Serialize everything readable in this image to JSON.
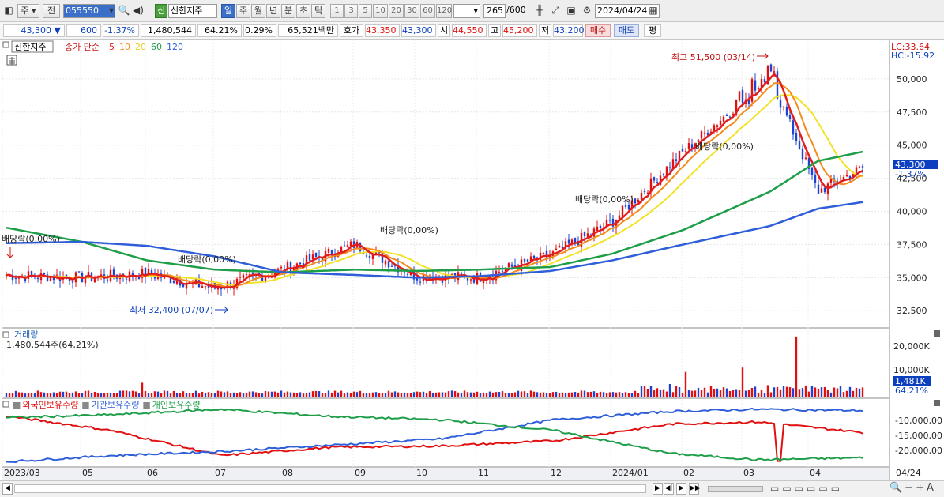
{
  "toolbar": {
    "market": "주",
    "prev": "전",
    "code": "055550",
    "badge": "신",
    "name": "신한지주",
    "periods": [
      "일",
      "주",
      "월",
      "년",
      "분",
      "초",
      "틱"
    ],
    "numbers": [
      "1",
      "3",
      "5",
      "10",
      "20",
      "30",
      "60",
      "120"
    ],
    "count": "265",
    "count_max": "/600",
    "date": "2024/04/24"
  },
  "quote": {
    "price": "43,300",
    "arrow": "▼",
    "change": "600",
    "change_pct": "-1.37%",
    "volume": "1,480,544",
    "vol_rate": "64.21%",
    "turnover": "0.29%",
    "amount": "65,521백만",
    "bid_label": "호가",
    "ask": "43,350",
    "bid": "43,300",
    "open_label": "시",
    "open": "44,550",
    "high_label": "고",
    "high": "45,200",
    "low_label": "저",
    "low": "43,200",
    "buy": "매수",
    "sell": "매도",
    "avg": "평"
  },
  "price_panel": {
    "name": "신한지주",
    "legend_title": "종가 단순",
    "ma": [
      {
        "label": "5",
        "color": "#e01e1e"
      },
      {
        "label": "10",
        "color": "#f28c1c"
      },
      {
        "label": "20",
        "color": "#e8d21a"
      },
      {
        "label": "60",
        "color": "#1f9e4a"
      },
      {
        "label": "120",
        "color": "#2f5fd8"
      }
    ],
    "lc": "LC:33.64",
    "hc": "HC:-15.92",
    "y_labels": [
      "50,000",
      "47,500",
      "45,000",
      "42,500",
      "40,000",
      "37,500",
      "35,000",
      "32,500"
    ],
    "last_price": "43,300",
    "last_pct": "-1.37%",
    "ann_high": "최고 51,500 (03/14)",
    "ann_low": "최저 32,400 (07/07)",
    "dividend": [
      "배당락(0,00%)",
      "배당락(0,00%)",
      "배당락(0,00%)",
      "배당락(0,00%)",
      "배당락(0,00%)"
    ]
  },
  "volume_panel": {
    "title": "거래량",
    "value": "1,480,544주(64,21%)",
    "y_labels": [
      "20,000K",
      "10,000K"
    ],
    "last": "1,481K",
    "last_pct": "64.21%"
  },
  "holding_panel": {
    "legend": [
      {
        "label": "외국인보유수량",
        "color": "#e01010"
      },
      {
        "label": "기관보유수량",
        "color": "#2f5fd8"
      },
      {
        "label": "개인보유수량",
        "color": "#1f9e4a"
      }
    ],
    "y_labels": [
      "-10,000,00",
      "-15,000,00",
      "-20,000,00"
    ]
  },
  "x_labels": [
    "2023/03",
    "05",
    "06",
    "07",
    "08",
    "09",
    "10",
    "11",
    "12",
    "2024/01",
    "02",
    "03",
    "04"
  ],
  "x_right": "04/24",
  "chart_data": [
    {
      "type": "line",
      "title": "",
      "x": [
        "2023/03",
        "05",
        "06",
        "07",
        "08",
        "09",
        "10",
        "11",
        "12",
        "2024/01",
        "02",
        "03",
        "04",
        "04/24"
      ],
      "series": [
        {
          "name": "5",
          "values": [
            35200,
            35000,
            35300,
            34200,
            35600,
            37500,
            35100,
            35000,
            36700,
            39200,
            44500,
            50200,
            41500,
            43300
          ]
        },
        {
          "name": "120",
          "values": [
            37600,
            37700,
            37400,
            36600,
            35400,
            35200,
            35000,
            35100,
            35500,
            36300,
            37500,
            38900,
            40200,
            40700
          ]
        }
      ],
      "ylim": [
        31500,
        52500
      ],
      "y_ticks": [
        32500,
        35000,
        37500,
        40000,
        42500,
        45000,
        47500,
        50000
      ],
      "high": 51500,
      "low": 32400
    },
    {
      "type": "bar",
      "title": "",
      "ylabel": "",
      "values_note": "",
      "last": 1481,
      "ylim": [
        0,
        25000
      ],
      "y_ticks": [
        10000,
        20000
      ]
    },
    {
      "type": "line",
      "title": "",
      "series": [
        {
          "name": "외국인보유수량",
          "values": [
            -10000,
            -13500,
            -19500,
            -17500,
            -17200,
            -16000,
            -12000,
            -11500,
            -14000
          ]
        },
        {
          "name": "기관보유수량",
          "values": [
            -21000,
            -19500,
            -18500,
            -17000,
            -15500,
            -11000,
            -9000,
            -8500,
            -8800
          ]
        },
        {
          "name": "개인보유수량",
          "values": [
            -10500,
            -9800,
            -8500,
            -10200,
            -11000,
            -13500,
            -19000,
            -20500,
            -20000
          ]
        }
      ],
      "ylim": [
        -22000,
        -7000
      ],
      "y_ticks": [
        -10000,
        -15000,
        -20000
      ]
    }
  ]
}
